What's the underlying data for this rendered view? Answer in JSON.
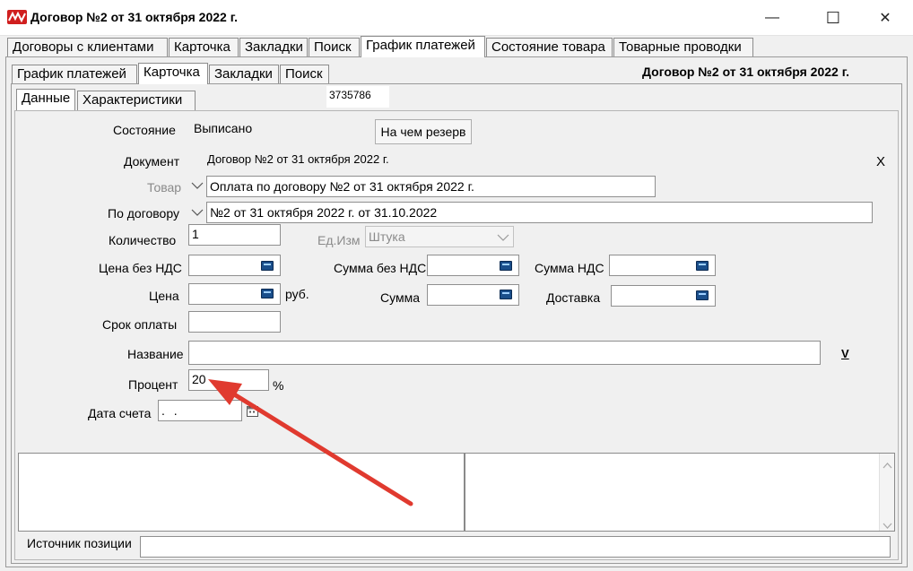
{
  "window": {
    "title": "Договор №2 от 31 октября 2022 г.",
    "minimize_glyph": "—",
    "maximize_glyph": "☐",
    "close_glyph": "✕"
  },
  "main_tabs": [
    {
      "label": "Договоры с клиентами"
    },
    {
      "label": "Карточка"
    },
    {
      "label": "Закладки"
    },
    {
      "label": "Поиск"
    },
    {
      "label": "График платежей"
    },
    {
      "label": "Состояние товара"
    },
    {
      "label": "Товарные проводки"
    }
  ],
  "sub_tabs": [
    {
      "label": "График платежей"
    },
    {
      "label": "Карточка"
    },
    {
      "label": "Закладки"
    },
    {
      "label": "Поиск"
    }
  ],
  "inner_tabs": [
    {
      "label": "Данные"
    },
    {
      "label": "Характеристики"
    }
  ],
  "header_right": "Договор №2 от 31 октября 2022 г.",
  "record_id": "3735786",
  "form": {
    "state_label": "Состояние",
    "state_value": "Выписано",
    "reserve_button": "На чем резерв",
    "document_label": "Документ",
    "document_value": "Договор №2 от 31 октября 2022 г.",
    "clear_x": "X",
    "product_label": "Товар",
    "product_value": "Оплата по договору №2 от 31 октября 2022 г.",
    "contract_label": "По договору",
    "contract_value": "№2 от 31 октября 2022 г. от 31.10.2022",
    "qty_label": "Количество",
    "qty_value": "1",
    "unit_label": "Ед.Изм",
    "unit_value": "Штука",
    "price_novat_label": "Цена без НДС",
    "price_novat_value": "",
    "sum_novat_label": "Сумма без НДС",
    "sum_novat_value": "",
    "vat_sum_label": "Сумма НДС",
    "vat_sum_value": "",
    "price_label": "Цена",
    "price_value": "",
    "currency": "руб.",
    "sum_label": "Сумма",
    "sum_value": "",
    "delivery_label": "Доставка",
    "delivery_value": "",
    "pay_term_label": "Срок оплаты",
    "pay_term_value": "",
    "name_label": "Название",
    "name_value": "",
    "name_dropdown": "V",
    "percent_label": "Процент",
    "percent_value": "20",
    "percent_sign": "%",
    "invoice_date_label": "Дата счета",
    "invoice_date_value": " .  .",
    "source_label": "Источник позиции",
    "source_value": ""
  },
  "colors": {
    "annotation_arrow": "#e03a2f",
    "window_bg": "#f0f0f0",
    "logo": "#d01f1f"
  }
}
